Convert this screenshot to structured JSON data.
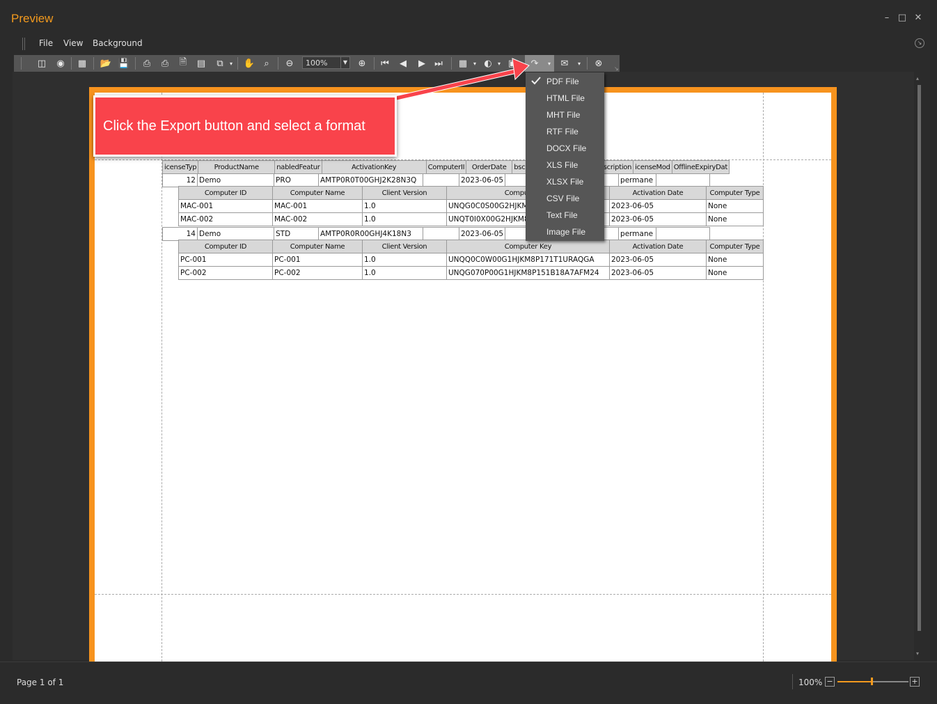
{
  "window": {
    "title": "Preview"
  },
  "menu": [
    "File",
    "View",
    "Background"
  ],
  "toolbar": {
    "zoom_value": "100%"
  },
  "callout": {
    "text": "Click the Export button and select a format",
    "color": "#f9434b"
  },
  "export_menu": {
    "selected": "PDF File",
    "items": [
      "PDF File",
      "HTML File",
      "MHT File",
      "RTF File",
      "DOCX File",
      "XLS File",
      "XLSX File",
      "CSV File",
      "Text File",
      "Image File"
    ]
  },
  "report": {
    "master_headers": [
      "icenseTyp",
      "ProductName",
      "nabledFeatur",
      "ActivationKey",
      "ComputerII",
      "OrderDate",
      "bscrip",
      "",
      "enewal",
      "ubscription",
      "icenseMod",
      "OfflineExpiryDat"
    ],
    "detail_headers": [
      "Computer ID",
      "Computer Name",
      "Client Version",
      "Computer Key",
      "Activation Date",
      "Computer Type"
    ],
    "groups": [
      {
        "master": [
          "12",
          "Demo",
          "PRO",
          "AMTP0R0T00GHJ2K28N3Q",
          "",
          "2023-06-05",
          "",
          "",
          "",
          "",
          "permane",
          ""
        ],
        "details": [
          [
            "MAC-001",
            "MAC-001",
            "1.0",
            "UNQG0C0S00G2HJKM8P151B18A7AFM26",
            "2023-06-05",
            "None"
          ],
          [
            "MAC-002",
            "MAC-002",
            "1.0",
            "UNQT0I0X00G2HJKM8P151B18A7AFM26",
            "2023-06-05",
            "None"
          ]
        ]
      },
      {
        "master": [
          "14",
          "Demo",
          "STD",
          "AMTP0R0R00GHJ4K18N3",
          "",
          "2023-06-05",
          "",
          "",
          "",
          "",
          "permane",
          ""
        ],
        "details": [
          [
            "PC-001",
            "PC-001",
            "1.0",
            "UNQQ0C0W00G1HJKM8P171T1URAQGA",
            "2023-06-05",
            "None"
          ],
          [
            "PC-002",
            "PC-002",
            "1.0",
            "UNQG070P00G1HJKM8P151B18A7AFM24",
            "2023-06-05",
            "None"
          ]
        ]
      }
    ]
  },
  "status": {
    "page": "Page 1 of 1",
    "zoom": "100%",
    "zoom_level": 0.5
  },
  "colors": {
    "accent": "#f39a1e",
    "page_border": "#f7931e"
  }
}
